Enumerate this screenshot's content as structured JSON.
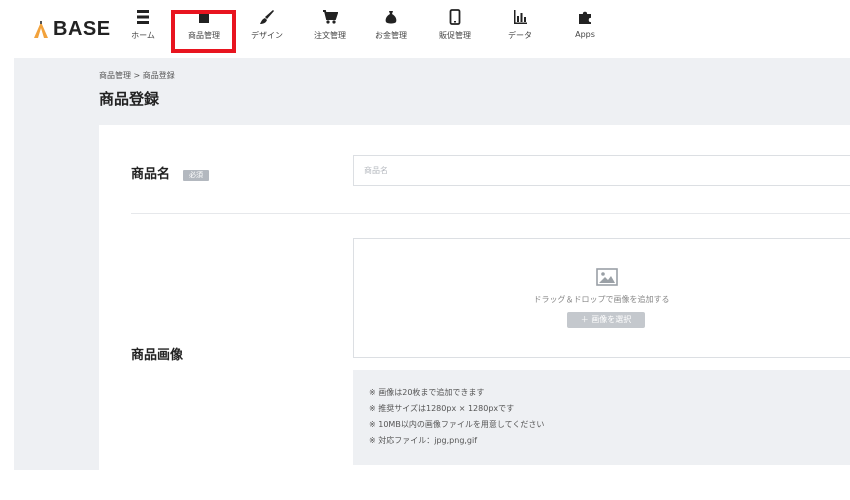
{
  "brand": {
    "logo_text": "BASE"
  },
  "nav": {
    "items": [
      {
        "label": "ホーム",
        "icon": "list-icon"
      },
      {
        "label": "商品管理",
        "icon": "product-icon"
      },
      {
        "label": "デザイン",
        "icon": "brush-icon"
      },
      {
        "label": "注文管理",
        "icon": "cart-icon"
      },
      {
        "label": "お金管理",
        "icon": "money-bag-icon"
      },
      {
        "label": "販促管理",
        "icon": "phone-icon"
      },
      {
        "label": "データ",
        "icon": "bar-chart-icon"
      },
      {
        "label": "Apps",
        "icon": "puzzle-icon"
      }
    ],
    "active_index": 1
  },
  "breadcrumb": "商品管理 > 商品登録",
  "page_title": "商品登録",
  "form": {
    "product_name": {
      "label": "商品名",
      "badge": "必須",
      "placeholder": "商品名",
      "value": ""
    },
    "product_image": {
      "label": "商品画像",
      "drop_text": "ドラッグ＆ドロップで画像を追加する",
      "select_button": "＋ 画像を選択",
      "notes": [
        "※ 画像は20枚まで追加できます",
        "※ 推奨サイズは1280px × 1280pxです",
        "※ 10MB以内の画像ファイルを用意してください",
        "※ 対応ファイル：jpg,png,gif"
      ]
    }
  },
  "colors": {
    "highlight": "#e8141f",
    "background": "#eef0f3",
    "logo_accent": "#f2a23c"
  }
}
